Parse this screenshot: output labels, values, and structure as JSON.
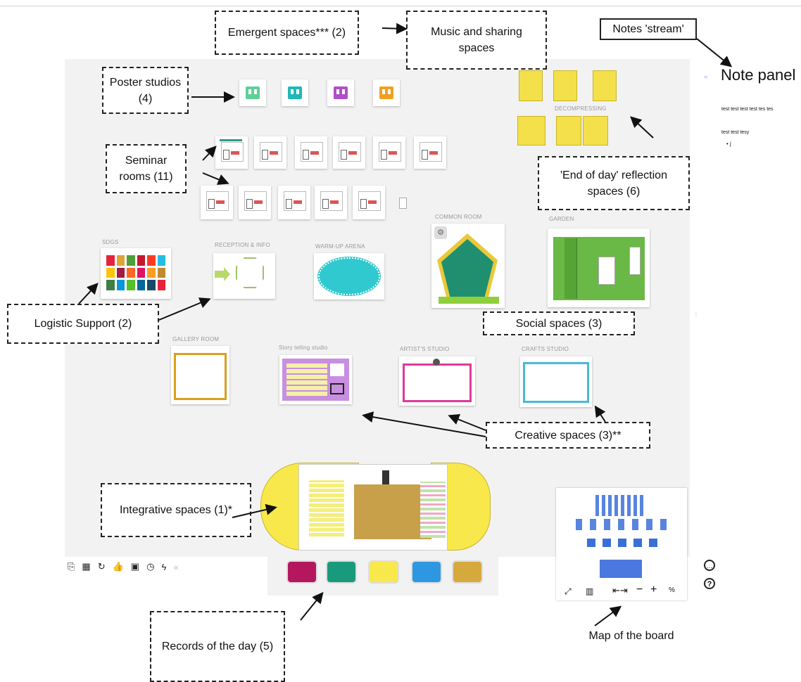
{
  "labels": {
    "emergent": "Emergent spaces*** (2)",
    "music": "Music and sharing spaces",
    "notes_stream": "Notes 'stream'",
    "poster": "Poster studios (4)",
    "seminar": "Seminar rooms (11)",
    "end_of_day": "'End of day' reflection spaces (6)",
    "logistic": "Logistic Support  (2)",
    "social": "Social spaces (3)",
    "creative": "Creative spaces (3)**",
    "integrative": "Integrative spaces (1)*",
    "records": "Records of the day (5)",
    "map": "Map of the board"
  },
  "board": {
    "sdgs": "SDGs",
    "reception": "RECEPTION & INFO",
    "warmup": "WARM-UP ARENA",
    "common_room": "COMMON ROOM",
    "garden": "GARDEN",
    "gallery": "GALLERY ROOM",
    "story": "Story telling studio",
    "artist": "ARTIST's STUDIO",
    "crafts": "CRAFTS STUDIO",
    "decompress": "DECOMPRESSING",
    "poster_colors": [
      "#5fcf99",
      "#1fb8b8",
      "#b04fc8",
      "#f0a020"
    ],
    "record_colors": [
      "#b5175f",
      "#1a9a7c",
      "#f8e84b",
      "#2e97e2",
      "#d6a93c"
    ],
    "sdg_colors": [
      "#e5243b",
      "#dda63a",
      "#4c9f38",
      "#c5192d",
      "#ff3a21",
      "#26bde2",
      "#fcc30b",
      "#a21942",
      "#fd6925",
      "#dd1367",
      "#fd9d24",
      "#bf8b2e",
      "#3f7e44",
      "#0a97d9",
      "#56c02b",
      "#00689d",
      "#19486a",
      "#e5243b"
    ]
  },
  "note_panel": {
    "title": "Note panel",
    "line1": "test test test test tes tes",
    "line2": "test test tesy",
    "bullet": "• j"
  },
  "toolbar": {
    "icons": [
      "share-icon",
      "grid-icon",
      "refresh-icon",
      "like-icon",
      "video-icon",
      "timer-icon",
      "bolt-icon",
      "more-icon"
    ]
  },
  "minimap": {
    "zoom_out": "−",
    "zoom_in": "+",
    "zoom_level": "%",
    "fit": "⇤⇥"
  }
}
